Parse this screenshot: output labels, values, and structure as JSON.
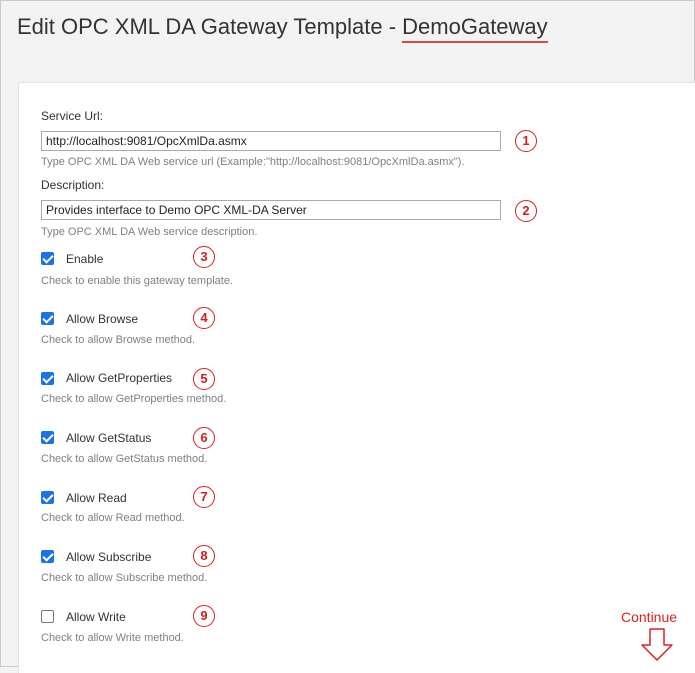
{
  "header": {
    "title_prefix": "Edit OPC XML DA Gateway Template - ",
    "gateway_name": "DemoGateway"
  },
  "form": {
    "service_url": {
      "label": "Service Url:",
      "value": "http://localhost:9081/OpcXmlDa.asmx",
      "help": "Type OPC XML DA Web service url (Example:\"http://localhost:9081/OpcXmlDa.asmx\").",
      "marker": "1"
    },
    "description": {
      "label": "Description:",
      "value": "Provides interface to Demo OPC XML-DA Server",
      "help": "Type OPC XML DA Web service description.",
      "marker": "2"
    },
    "checkboxes": [
      {
        "label": "Enable",
        "help": "Check to enable this gateway template.",
        "checked": true,
        "marker": "3"
      },
      {
        "label": "Allow Browse",
        "help": "Check to allow Browse method.",
        "checked": true,
        "marker": "4"
      },
      {
        "label": "Allow GetProperties",
        "help": "Check to allow GetProperties method.",
        "checked": true,
        "marker": "5"
      },
      {
        "label": "Allow GetStatus",
        "help": "Check to allow GetStatus method.",
        "checked": true,
        "marker": "6"
      },
      {
        "label": "Allow Read",
        "help": "Check to allow Read method.",
        "checked": true,
        "marker": "7"
      },
      {
        "label": "Allow Subscribe",
        "help": "Check to allow Subscribe method.",
        "checked": true,
        "marker": "8"
      },
      {
        "label": "Allow Write",
        "help": "Check to allow Write method.",
        "checked": false,
        "marker": "9"
      }
    ]
  },
  "annotation": {
    "continue_label": "Continue",
    "icon": "down-arrow-icon"
  },
  "colors": {
    "accent": "#1a73e8",
    "marker": "#d42020",
    "underline": "#d64a4a"
  }
}
